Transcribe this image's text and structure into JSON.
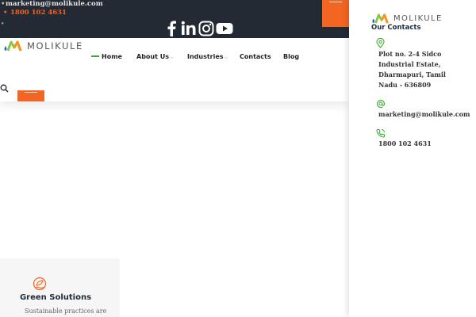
{
  "topbar": {
    "email": "marketing@molikule.com",
    "phone": "1800 102 4631",
    "socials": [
      "facebook-icon",
      "linkedin-icon",
      "instagram-icon",
      "youtube-icon"
    ]
  },
  "brand": {
    "name": "MOLIKULE"
  },
  "nav": {
    "items": [
      {
        "label": "Home",
        "active": true
      },
      {
        "label": "About Us",
        "dropdown": true
      },
      {
        "label": "Industries",
        "dropdown": true
      },
      {
        "label": "Contacts"
      },
      {
        "label": "Blog"
      }
    ]
  },
  "card": {
    "title": "Green Solutions",
    "text": "Sustainable practices are"
  },
  "panel": {
    "heading": "Our Contacts",
    "address": "Plot no. 2-4 Sidco Industrial Estate, Dharmapuri, Tamil Nadu - 636809",
    "email": "marketing@molikule.com",
    "phone": "1800 102 4631"
  },
  "colors": {
    "accent_orange": "#f26522",
    "accent_green": "#3aa935",
    "topbar_bg": "#232a33"
  }
}
